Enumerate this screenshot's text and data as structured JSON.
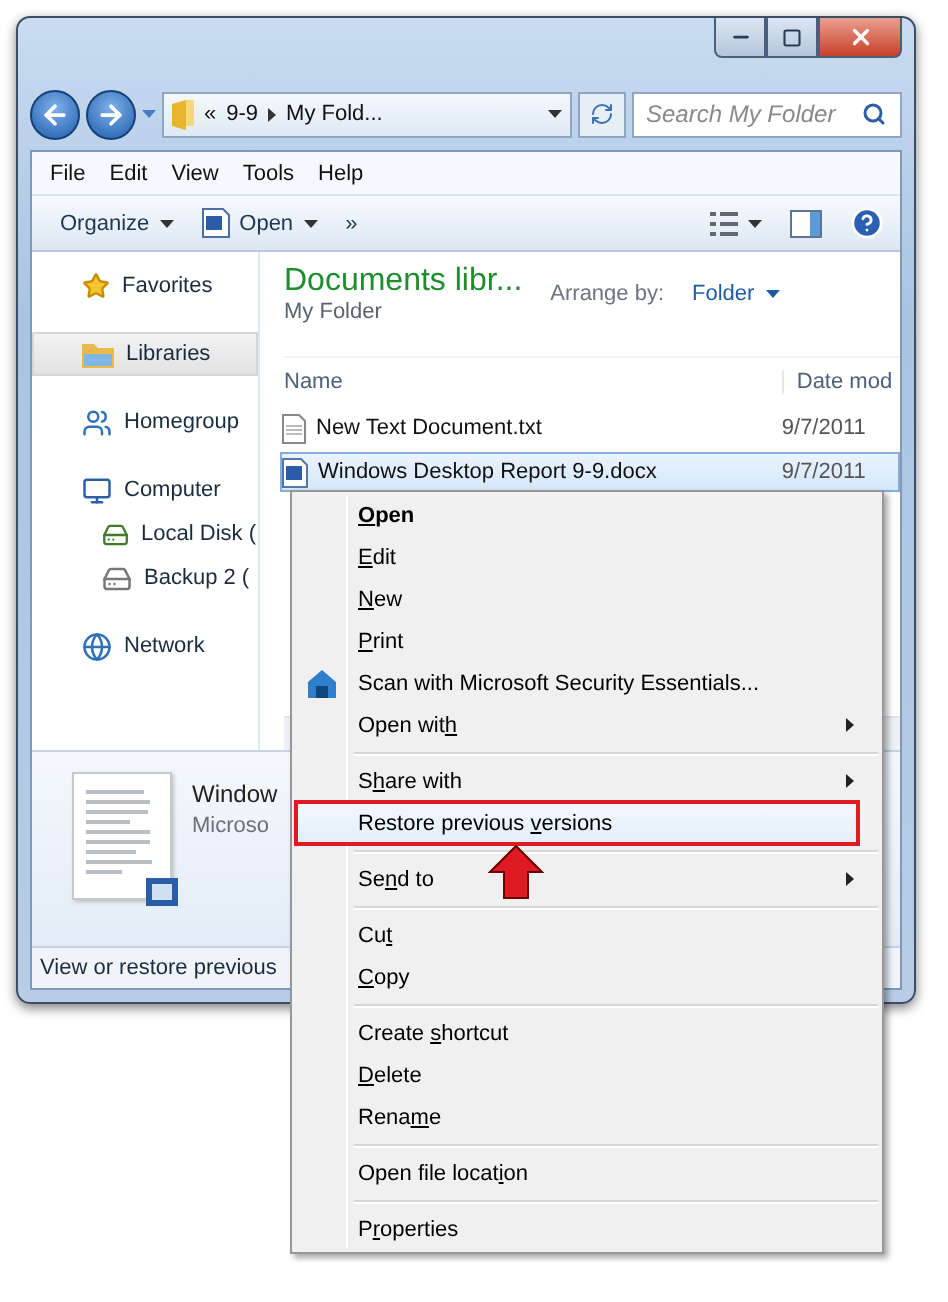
{
  "address": {
    "overflow": "«",
    "crumbs": [
      "9-9",
      "My Fold..."
    ]
  },
  "search": {
    "placeholder": "Search My Folder"
  },
  "menu_bar": [
    "File",
    "Edit",
    "View",
    "Tools",
    "Help"
  ],
  "toolbar": [
    {
      "label": "Organize",
      "dropdown": true,
      "has_icon": false
    },
    {
      "label": "Open",
      "dropdown": true,
      "has_icon": true
    },
    {
      "label": "»",
      "dropdown": false,
      "has_icon": false
    }
  ],
  "sidebar": {
    "items": [
      {
        "label": "Favorites",
        "kind": "favorites",
        "selected": false
      },
      {
        "label": "Libraries",
        "kind": "libraries",
        "selected": true
      },
      {
        "label": "Homegroup",
        "kind": "homegroup",
        "selected": false
      },
      {
        "label": "Computer",
        "kind": "computer",
        "selected": false,
        "children": [
          {
            "label": "Local Disk (",
            "kind": "system-disk",
            "selected": false
          },
          {
            "label": "Backup 2 (",
            "kind": "drive",
            "selected": false
          }
        ]
      },
      {
        "label": "Network",
        "kind": "network",
        "selected": false
      }
    ]
  },
  "library": {
    "title": "Documents libr...",
    "subtitle": "My Folder",
    "arrange_label": "Arrange by:",
    "arrange_value": "Folder"
  },
  "table": {
    "columns": [
      "Name",
      "Date mod"
    ],
    "rows": [
      {
        "name": "New Text Document.txt",
        "date": "9/7/2011",
        "kind": "text",
        "selected": false
      },
      {
        "name": "Windows Desktop Report 9-9.docx",
        "date": "9/7/2011",
        "kind": "word",
        "selected": true
      }
    ]
  },
  "details": {
    "name": "Window",
    "type": "Microso"
  },
  "status_bar": "View or restore previous",
  "context_menu": {
    "items": [
      {
        "kind": "item",
        "label": [
          {
            "text": "O",
            "key": true
          },
          {
            "text": "pen",
            "key": false
          }
        ],
        "bold": true,
        "submenu": false,
        "has_icon": false,
        "selected": false
      },
      {
        "kind": "item",
        "label": [
          {
            "text": "E",
            "key": true
          },
          {
            "text": "dit",
            "key": false
          }
        ],
        "bold": false,
        "submenu": false,
        "has_icon": false,
        "selected": false
      },
      {
        "kind": "item",
        "label": [
          {
            "text": "N",
            "key": true
          },
          {
            "text": "ew",
            "key": false
          }
        ],
        "bold": false,
        "submenu": false,
        "has_icon": false,
        "selected": false
      },
      {
        "kind": "item",
        "label": [
          {
            "text": "P",
            "key": true
          },
          {
            "text": "rint",
            "key": false
          }
        ],
        "bold": false,
        "submenu": false,
        "has_icon": false,
        "selected": false
      },
      {
        "kind": "item",
        "label": [
          {
            "text": "Scan with Microsoft Security Essentials...",
            "key": false
          }
        ],
        "bold": false,
        "submenu": false,
        "has_icon": true,
        "selected": false
      },
      {
        "kind": "item",
        "label": [
          {
            "text": "Open wit",
            "key": false
          },
          {
            "text": "h",
            "key": true
          }
        ],
        "bold": false,
        "submenu": true,
        "has_icon": false,
        "selected": false
      },
      {
        "kind": "separator"
      },
      {
        "kind": "item",
        "label": [
          {
            "text": "S",
            "key": false
          },
          {
            "text": "h",
            "key": true
          },
          {
            "text": "are with",
            "key": false
          }
        ],
        "bold": false,
        "submenu": true,
        "has_icon": false,
        "selected": false
      },
      {
        "kind": "item",
        "label": [
          {
            "text": "Restore previous ",
            "key": false
          },
          {
            "text": "v",
            "key": true
          },
          {
            "text": "ersions",
            "key": false
          }
        ],
        "bold": false,
        "submenu": false,
        "has_icon": false,
        "selected": true
      },
      {
        "kind": "separator"
      },
      {
        "kind": "item",
        "label": [
          {
            "text": "Se",
            "key": false
          },
          {
            "text": "n",
            "key": true
          },
          {
            "text": "d to",
            "key": false
          }
        ],
        "bold": false,
        "submenu": true,
        "has_icon": false,
        "selected": false
      },
      {
        "kind": "separator"
      },
      {
        "kind": "item",
        "label": [
          {
            "text": "Cu",
            "key": false
          },
          {
            "text": "t",
            "key": true
          }
        ],
        "bold": false,
        "submenu": false,
        "has_icon": false,
        "selected": false
      },
      {
        "kind": "item",
        "label": [
          {
            "text": "C",
            "key": true
          },
          {
            "text": "opy",
            "key": false
          }
        ],
        "bold": false,
        "submenu": false,
        "has_icon": false,
        "selected": false
      },
      {
        "kind": "separator"
      },
      {
        "kind": "item",
        "label": [
          {
            "text": "Create ",
            "key": false
          },
          {
            "text": "s",
            "key": true
          },
          {
            "text": "hortcut",
            "key": false
          }
        ],
        "bold": false,
        "submenu": false,
        "has_icon": false,
        "selected": false
      },
      {
        "kind": "item",
        "label": [
          {
            "text": "D",
            "key": true
          },
          {
            "text": "elete",
            "key": false
          }
        ],
        "bold": false,
        "submenu": false,
        "has_icon": false,
        "selected": false
      },
      {
        "kind": "item",
        "label": [
          {
            "text": "Rena",
            "key": false
          },
          {
            "text": "m",
            "key": true
          },
          {
            "text": "e",
            "key": false
          }
        ],
        "bold": false,
        "submenu": false,
        "has_icon": false,
        "selected": false
      },
      {
        "kind": "separator"
      },
      {
        "kind": "item",
        "label": [
          {
            "text": "Open file locat",
            "key": false
          },
          {
            "text": "i",
            "key": true
          },
          {
            "text": "on",
            "key": false
          }
        ],
        "bold": false,
        "submenu": false,
        "has_icon": false,
        "selected": false
      },
      {
        "kind": "separator"
      },
      {
        "kind": "item",
        "label": [
          {
            "text": "P",
            "key": false
          },
          {
            "text": "r",
            "key": true
          },
          {
            "text": "operties",
            "key": false
          }
        ],
        "bold": false,
        "submenu": false,
        "has_icon": false,
        "selected": false
      }
    ]
  }
}
